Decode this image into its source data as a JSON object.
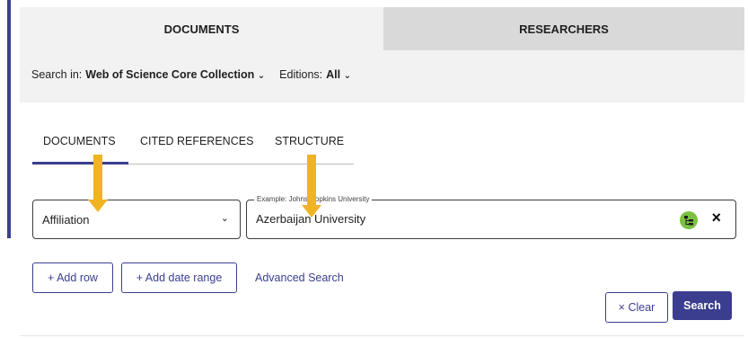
{
  "top_tabs": {
    "documents": "DOCUMENTS",
    "researchers": "RESEARCHERS"
  },
  "search_in": {
    "label": "Search in:",
    "collection": "Web of Science Core Collection",
    "editions_label": "Editions:",
    "editions_value": "All"
  },
  "sub_tabs": [
    "DOCUMENTS",
    "CITED REFERENCES",
    "STRUCTURE"
  ],
  "row": {
    "field_select_value": "Affiliation",
    "input_legend": "Example: Johns Hopkins University",
    "input_value": "Azerbaijan University",
    "clear_symbol": "×"
  },
  "buttons": {
    "add_row": "+ Add row",
    "add_date_range": "+ Add date range",
    "advanced_search": "Advanced Search",
    "clear": "× Clear",
    "search": "Search"
  },
  "colors": {
    "accent": "#3b3e8f",
    "annotation_arrow": "#f0b323",
    "tree_icon": "#7ac142"
  },
  "icons": [
    "chevron-down-icon",
    "tree-selector-icon",
    "close-icon",
    "arrow-annotation-icon"
  ]
}
